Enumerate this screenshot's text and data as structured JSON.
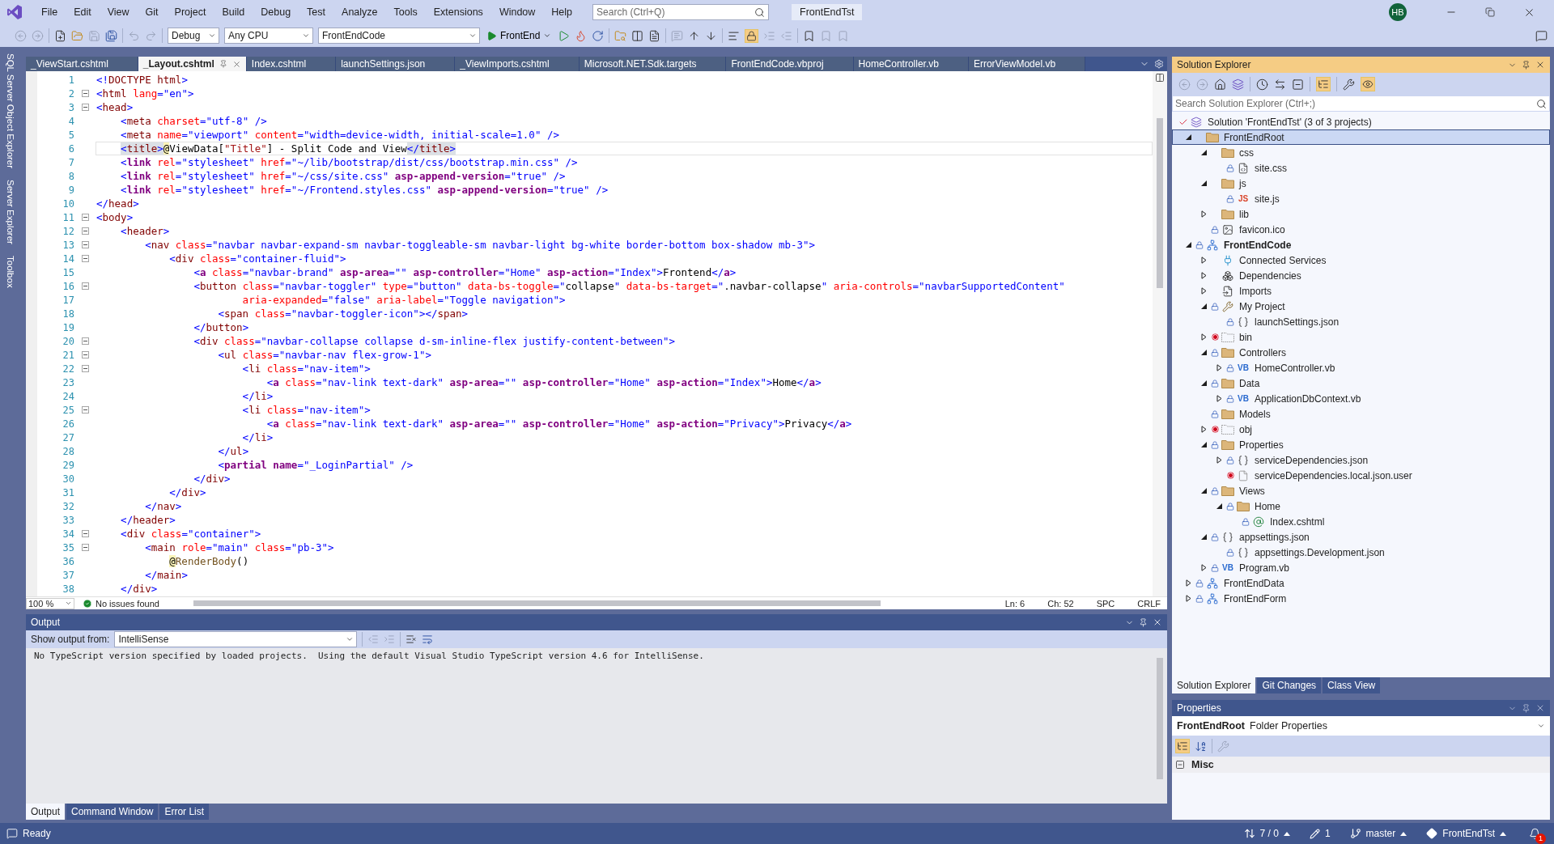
{
  "menu": [
    "File",
    "Edit",
    "View",
    "Git",
    "Project",
    "Build",
    "Debug",
    "Test",
    "Analyze",
    "Tools",
    "Extensions",
    "Window",
    "Help"
  ],
  "search": {
    "placeholder": "Search (Ctrl+Q)"
  },
  "solution_name": "FrontEndTst",
  "user_avatar": "HB",
  "toolbar": {
    "configuration": "Debug",
    "platform": "Any CPU",
    "startup_project": "FrontEndCode",
    "run_label": "FrontEnd"
  },
  "side_tabs": [
    "SQL Server Object Explorer",
    "Server Explorer",
    "Toolbox"
  ],
  "editor_tabs": [
    {
      "label": "_ViewStart.cshtml",
      "selected": false
    },
    {
      "label": "_Layout.cshtml",
      "selected": true
    },
    {
      "label": "Index.cshtml",
      "selected": false
    },
    {
      "label": "launchSettings.json",
      "selected": false
    },
    {
      "label": "_ViewImports.cshtml",
      "selected": false
    },
    {
      "label": "Microsoft.NET.Sdk.targets",
      "selected": false
    },
    {
      "label": "FrontEndCode.vbproj",
      "selected": false
    },
    {
      "label": "HomeController.vb",
      "selected": false
    },
    {
      "label": "ErrorViewModel.vb",
      "selected": false
    }
  ],
  "code_lines": [
    {
      "number": "1",
      "fold": false,
      "current": false,
      "tokens": [
        {
          "kind": "delim",
          "text": "<!"
        },
        {
          "kind": "tag",
          "text": "DOCTYPE html"
        },
        {
          "kind": "delim",
          "text": ">"
        }
      ]
    },
    {
      "number": "2",
      "fold": true,
      "current": false,
      "tokens": [
        {
          "kind": "delim",
          "text": "<"
        },
        {
          "kind": "tag",
          "text": "html "
        },
        {
          "kind": "attr",
          "text": "lang"
        },
        {
          "kind": "delim",
          "text": "=\"en\">"
        }
      ]
    },
    {
      "number": "3",
      "fold": true,
      "current": false,
      "tokens": [
        {
          "kind": "delim",
          "text": "<"
        },
        {
          "kind": "tag",
          "text": "head"
        },
        {
          "kind": "delim",
          "text": ">"
        }
      ]
    },
    {
      "number": "4",
      "fold": false,
      "current": false,
      "tokens": [
        {
          "kind": "delim",
          "text": "    <"
        },
        {
          "kind": "tag",
          "text": "meta "
        },
        {
          "kind": "attr",
          "text": "charset"
        },
        {
          "kind": "delim",
          "text": "=\"utf-8\" />"
        }
      ]
    },
    {
      "number": "5",
      "fold": false,
      "current": false,
      "tokens": [
        {
          "kind": "delim",
          "text": "    <"
        },
        {
          "kind": "tag",
          "text": "meta "
        },
        {
          "kind": "attr",
          "text": "name"
        },
        {
          "kind": "delim",
          "text": "=\"viewport\" "
        },
        {
          "kind": "attr",
          "text": "content"
        },
        {
          "kind": "delim",
          "text": "=\"width=device-width, initial-scale=1.0\" />"
        }
      ]
    },
    {
      "number": "6",
      "fold": false,
      "current": true,
      "tokens": [
        {
          "kind": "delim",
          "text": "    <",
          "matched": true
        },
        {
          "kind": "tag",
          "text": "title",
          "matched": true
        },
        {
          "kind": "delim",
          "text": ">",
          "matched": true
        },
        {
          "kind": "razor",
          "text": "@"
        },
        {
          "kind": "text",
          "text": "ViewData["
        },
        {
          "kind": "string",
          "text": "\"Title\""
        },
        {
          "kind": "text",
          "text": "] - Split Code and View"
        },
        {
          "kind": "delim",
          "text": "</",
          "matched": true
        },
        {
          "kind": "tag",
          "text": "title",
          "matched": true
        },
        {
          "kind": "delim",
          "text": ">",
          "matched": true
        }
      ]
    },
    {
      "number": "7",
      "fold": false,
      "current": false,
      "tokens": [
        {
          "kind": "delim",
          "text": "    <"
        },
        {
          "kind": "helper",
          "text": "link "
        },
        {
          "kind": "attr",
          "text": "rel"
        },
        {
          "kind": "delim",
          "text": "=\"stylesheet\" "
        },
        {
          "kind": "attr",
          "text": "href"
        },
        {
          "kind": "delim",
          "text": "=\"~/lib/bootstrap/dist/css/bootstrap.min.css\" />"
        }
      ]
    },
    {
      "number": "8",
      "fold": false,
      "current": false,
      "tokens": [
        {
          "kind": "delim",
          "text": "    <"
        },
        {
          "kind": "helper",
          "text": "link "
        },
        {
          "kind": "attr",
          "text": "rel"
        },
        {
          "kind": "delim",
          "text": "=\"stylesheet\" "
        },
        {
          "kind": "attr",
          "text": "href"
        },
        {
          "kind": "delim",
          "text": "=\"~/css/site.css\" "
        },
        {
          "kind": "helper",
          "text": "asp-append-version"
        },
        {
          "kind": "delim",
          "text": "=\"true\" />"
        }
      ]
    },
    {
      "number": "9",
      "fold": false,
      "current": false,
      "tokens": [
        {
          "kind": "delim",
          "text": "    <"
        },
        {
          "kind": "helper",
          "text": "link "
        },
        {
          "kind": "attr",
          "text": "rel"
        },
        {
          "kind": "delim",
          "text": "=\"stylesheet\" "
        },
        {
          "kind": "attr",
          "text": "href"
        },
        {
          "kind": "delim",
          "text": "=\"~/Frontend.styles.css\" "
        },
        {
          "kind": "helper",
          "text": "asp-append-version"
        },
        {
          "kind": "delim",
          "text": "=\"true\" />"
        }
      ]
    },
    {
      "number": "10",
      "fold": false,
      "current": false,
      "tokens": [
        {
          "kind": "delim",
          "text": "</"
        },
        {
          "kind": "tag",
          "text": "head"
        },
        {
          "kind": "delim",
          "text": ">"
        }
      ]
    },
    {
      "number": "11",
      "fold": true,
      "current": false,
      "tokens": [
        {
          "kind": "delim",
          "text": "<"
        },
        {
          "kind": "tag",
          "text": "body"
        },
        {
          "kind": "delim",
          "text": ">"
        }
      ]
    },
    {
      "number": "12",
      "fold": true,
      "current": false,
      "tokens": [
        {
          "kind": "delim",
          "text": "    <"
        },
        {
          "kind": "tag",
          "text": "header"
        },
        {
          "kind": "delim",
          "text": ">"
        }
      ]
    },
    {
      "number": "13",
      "fold": true,
      "current": false,
      "tokens": [
        {
          "kind": "delim",
          "text": "        <"
        },
        {
          "kind": "tag",
          "text": "nav "
        },
        {
          "kind": "attr",
          "text": "class"
        },
        {
          "kind": "delim",
          "text": "=\"navbar navbar-expand-sm navbar-toggleable-sm navbar-light bg-white border-bottom box-shadow mb-3\">"
        }
      ]
    },
    {
      "number": "14",
      "fold": true,
      "current": false,
      "tokens": [
        {
          "kind": "delim",
          "text": "            <"
        },
        {
          "kind": "tag",
          "text": "div "
        },
        {
          "kind": "attr",
          "text": "class"
        },
        {
          "kind": "delim",
          "text": "=\"container-fluid\">"
        }
      ]
    },
    {
      "number": "15",
      "fold": false,
      "current": false,
      "tokens": [
        {
          "kind": "delim",
          "text": "                <"
        },
        {
          "kind": "helper",
          "text": "a "
        },
        {
          "kind": "attr",
          "text": "class"
        },
        {
          "kind": "delim",
          "text": "=\"navbar-brand\" "
        },
        {
          "kind": "helper",
          "text": "asp-area"
        },
        {
          "kind": "delim",
          "text": "=\"\" "
        },
        {
          "kind": "helper",
          "text": "asp-controller"
        },
        {
          "kind": "delim",
          "text": "=\"Home\" "
        },
        {
          "kind": "helper",
          "text": "asp-action"
        },
        {
          "kind": "delim",
          "text": "=\"Index\">"
        },
        {
          "kind": "text",
          "text": "Frontend"
        },
        {
          "kind": "delim",
          "text": "</"
        },
        {
          "kind": "helper",
          "text": "a"
        },
        {
          "kind": "delim",
          "text": ">"
        }
      ]
    },
    {
      "number": "16",
      "fold": true,
      "current": false,
      "tokens": [
        {
          "kind": "delim",
          "text": "                <"
        },
        {
          "kind": "tag",
          "text": "button "
        },
        {
          "kind": "attr",
          "text": "class"
        },
        {
          "kind": "delim",
          "text": "=\"navbar-toggler\" "
        },
        {
          "kind": "attr",
          "text": "type"
        },
        {
          "kind": "delim",
          "text": "=\"button\" "
        },
        {
          "kind": "attr",
          "text": "data-bs-toggle"
        },
        {
          "kind": "delim",
          "text": "=\""
        },
        {
          "kind": "text",
          "text": "collapse"
        },
        {
          "kind": "delim",
          "text": "\" "
        },
        {
          "kind": "attr",
          "text": "data-bs-target"
        },
        {
          "kind": "delim",
          "text": "=\""
        },
        {
          "kind": "text",
          "text": ".navbar-collapse"
        },
        {
          "kind": "delim",
          "text": "\" "
        },
        {
          "kind": "attr",
          "text": "aria-controls"
        },
        {
          "kind": "delim",
          "text": "=\"navbarSupportedContent\""
        }
      ]
    },
    {
      "number": "17",
      "fold": false,
      "current": false,
      "tokens": [
        {
          "kind": "attr",
          "text": "                        aria-expanded"
        },
        {
          "kind": "delim",
          "text": "=\"false\" "
        },
        {
          "kind": "attr",
          "text": "aria-label"
        },
        {
          "kind": "delim",
          "text": "=\"Toggle navigation\">"
        }
      ]
    },
    {
      "number": "18",
      "fold": false,
      "current": false,
      "tokens": [
        {
          "kind": "delim",
          "text": "                    <"
        },
        {
          "kind": "tag",
          "text": "span "
        },
        {
          "kind": "attr",
          "text": "class"
        },
        {
          "kind": "delim",
          "text": "=\"navbar-toggler-icon\"></"
        },
        {
          "kind": "tag",
          "text": "span"
        },
        {
          "kind": "delim",
          "text": ">"
        }
      ]
    },
    {
      "number": "19",
      "fold": false,
      "current": false,
      "tokens": [
        {
          "kind": "delim",
          "text": "                </"
        },
        {
          "kind": "tag",
          "text": "button"
        },
        {
          "kind": "delim",
          "text": ">"
        }
      ]
    },
    {
      "number": "20",
      "fold": true,
      "current": false,
      "tokens": [
        {
          "kind": "delim",
          "text": "                <"
        },
        {
          "kind": "tag",
          "text": "div "
        },
        {
          "kind": "attr",
          "text": "class"
        },
        {
          "kind": "delim",
          "text": "=\"navbar-collapse collapse d-sm-inline-flex justify-content-between\">"
        }
      ]
    },
    {
      "number": "21",
      "fold": true,
      "current": false,
      "tokens": [
        {
          "kind": "delim",
          "text": "                    <"
        },
        {
          "kind": "tag",
          "text": "ul "
        },
        {
          "kind": "attr",
          "text": "class"
        },
        {
          "kind": "delim",
          "text": "=\"navbar-nav flex-grow-1\">"
        }
      ]
    },
    {
      "number": "22",
      "fold": true,
      "current": false,
      "tokens": [
        {
          "kind": "delim",
          "text": "                        <"
        },
        {
          "kind": "tag",
          "text": "li "
        },
        {
          "kind": "attr",
          "text": "class"
        },
        {
          "kind": "delim",
          "text": "=\"nav-item\">"
        }
      ]
    },
    {
      "number": "23",
      "fold": false,
      "current": false,
      "tokens": [
        {
          "kind": "delim",
          "text": "                            <"
        },
        {
          "kind": "helper",
          "text": "a "
        },
        {
          "kind": "attr",
          "text": "class"
        },
        {
          "kind": "delim",
          "text": "=\"nav-link text-dark\" "
        },
        {
          "kind": "helper",
          "text": "asp-area"
        },
        {
          "kind": "delim",
          "text": "=\"\" "
        },
        {
          "kind": "helper",
          "text": "asp-controller"
        },
        {
          "kind": "delim",
          "text": "=\"Home\" "
        },
        {
          "kind": "helper",
          "text": "asp-action"
        },
        {
          "kind": "delim",
          "text": "=\"Index\">"
        },
        {
          "kind": "text",
          "text": "Home"
        },
        {
          "kind": "delim",
          "text": "</"
        },
        {
          "kind": "helper",
          "text": "a"
        },
        {
          "kind": "delim",
          "text": ">"
        }
      ]
    },
    {
      "number": "24",
      "fold": false,
      "current": false,
      "tokens": [
        {
          "kind": "delim",
          "text": "                        </"
        },
        {
          "kind": "tag",
          "text": "li"
        },
        {
          "kind": "delim",
          "text": ">"
        }
      ]
    },
    {
      "number": "25",
      "fold": true,
      "current": false,
      "tokens": [
        {
          "kind": "delim",
          "text": "                        <"
        },
        {
          "kind": "tag",
          "text": "li "
        },
        {
          "kind": "attr",
          "text": "class"
        },
        {
          "kind": "delim",
          "text": "=\"nav-item\">"
        }
      ]
    },
    {
      "number": "26",
      "fold": false,
      "current": false,
      "tokens": [
        {
          "kind": "delim",
          "text": "                            <"
        },
        {
          "kind": "helper",
          "text": "a "
        },
        {
          "kind": "attr",
          "text": "class"
        },
        {
          "kind": "delim",
          "text": "=\"nav-link text-dark\" "
        },
        {
          "kind": "helper",
          "text": "asp-area"
        },
        {
          "kind": "delim",
          "text": "=\"\" "
        },
        {
          "kind": "helper",
          "text": "asp-controller"
        },
        {
          "kind": "delim",
          "text": "=\"Home\" "
        },
        {
          "kind": "helper",
          "text": "asp-action"
        },
        {
          "kind": "delim",
          "text": "=\"Privacy\">"
        },
        {
          "kind": "text",
          "text": "Privacy"
        },
        {
          "kind": "delim",
          "text": "</"
        },
        {
          "kind": "helper",
          "text": "a"
        },
        {
          "kind": "delim",
          "text": ">"
        }
      ]
    },
    {
      "number": "27",
      "fold": false,
      "current": false,
      "tokens": [
        {
          "kind": "delim",
          "text": "                        </"
        },
        {
          "kind": "tag",
          "text": "li"
        },
        {
          "kind": "delim",
          "text": ">"
        }
      ]
    },
    {
      "number": "28",
      "fold": false,
      "current": false,
      "tokens": [
        {
          "kind": "delim",
          "text": "                    </"
        },
        {
          "kind": "tag",
          "text": "ul"
        },
        {
          "kind": "delim",
          "text": ">"
        }
      ]
    },
    {
      "number": "29",
      "fold": false,
      "current": false,
      "tokens": [
        {
          "kind": "delim",
          "text": "                    <"
        },
        {
          "kind": "helper",
          "text": "partial "
        },
        {
          "kind": "helper",
          "text": "name"
        },
        {
          "kind": "delim",
          "text": "=\"_LoginPartial\" />"
        }
      ]
    },
    {
      "number": "30",
      "fold": false,
      "current": false,
      "tokens": [
        {
          "kind": "delim",
          "text": "                </"
        },
        {
          "kind": "tag",
          "text": "div"
        },
        {
          "kind": "delim",
          "text": ">"
        }
      ]
    },
    {
      "number": "31",
      "fold": false,
      "current": false,
      "tokens": [
        {
          "kind": "delim",
          "text": "            </"
        },
        {
          "kind": "tag",
          "text": "div"
        },
        {
          "kind": "delim",
          "text": ">"
        }
      ]
    },
    {
      "number": "32",
      "fold": false,
      "current": false,
      "tokens": [
        {
          "kind": "delim",
          "text": "        </"
        },
        {
          "kind": "tag",
          "text": "nav"
        },
        {
          "kind": "delim",
          "text": ">"
        }
      ]
    },
    {
      "number": "33",
      "fold": false,
      "current": false,
      "tokens": [
        {
          "kind": "delim",
          "text": "    </"
        },
        {
          "kind": "tag",
          "text": "header"
        },
        {
          "kind": "delim",
          "text": ">"
        }
      ]
    },
    {
      "number": "34",
      "fold": true,
      "current": false,
      "tokens": [
        {
          "kind": "delim",
          "text": "    <"
        },
        {
          "kind": "tag",
          "text": "div "
        },
        {
          "kind": "attr",
          "text": "class"
        },
        {
          "kind": "delim",
          "text": "=\"container\">"
        }
      ]
    },
    {
      "number": "35",
      "fold": true,
      "current": false,
      "tokens": [
        {
          "kind": "delim",
          "text": "        <"
        },
        {
          "kind": "tag",
          "text": "main "
        },
        {
          "kind": "attr",
          "text": "role"
        },
        {
          "kind": "delim",
          "text": "=\"main\" "
        },
        {
          "kind": "attr",
          "text": "class"
        },
        {
          "kind": "delim",
          "text": "=\"pb-3\">"
        }
      ]
    },
    {
      "number": "36",
      "fold": false,
      "current": false,
      "tokens": [
        {
          "kind": "razor",
          "text": "            @"
        },
        {
          "kind": "method",
          "text": "RenderBody"
        },
        {
          "kind": "text",
          "text": "()"
        }
      ]
    },
    {
      "number": "37",
      "fold": false,
      "current": false,
      "tokens": [
        {
          "kind": "delim",
          "text": "        </"
        },
        {
          "kind": "tag",
          "text": "main"
        },
        {
          "kind": "delim",
          "text": ">"
        }
      ]
    },
    {
      "number": "38",
      "fold": false,
      "current": false,
      "tokens": [
        {
          "kind": "delim",
          "text": "    </"
        },
        {
          "kind": "tag",
          "text": "div"
        },
        {
          "kind": "delim",
          "text": ">"
        }
      ]
    }
  ],
  "editor_status": {
    "zoom": "100 %",
    "issues": "No issues found",
    "line": "Ln: 6",
    "column": "Ch: 52",
    "spacing": "SPC",
    "line_ending": "CRLF"
  },
  "output": {
    "title": "Output",
    "source_label": "Show output from:",
    "source": "IntelliSense",
    "text": "No TypeScript version specified by loaded projects.  Using the default Visual Studio TypeScript version 4.6 for IntelliSense.",
    "tabs": [
      {
        "label": "Output",
        "selected": true
      },
      {
        "label": "Command Window",
        "selected": false
      },
      {
        "label": "Error List",
        "selected": false
      }
    ]
  },
  "solution_explorer": {
    "title": "Solution Explorer",
    "search_placeholder": "Search Solution Explorer (Ctrl+;)",
    "tree": {
      "label": "Solution 'FrontEndTst' (3 of 3 projects)",
      "kind": "solution",
      "locked": false,
      "excluded": false,
      "selected": false,
      "children": [
        {
          "label": "FrontEndRoot",
          "kind": "folder",
          "locked": false,
          "excluded": false,
          "expanded": true,
          "selected": true,
          "children": [
            {
              "label": "css",
              "kind": "folder",
              "locked": false,
              "excluded": false,
              "expanded": true,
              "selected": false,
              "children": [
                {
                  "label": "site.css",
                  "kind": "css",
                  "locked": true,
                  "excluded": false,
                  "selected": false
                }
              ]
            },
            {
              "label": "js",
              "kind": "folder",
              "locked": false,
              "excluded": false,
              "expanded": true,
              "selected": false,
              "children": [
                {
                  "label": "site.js",
                  "kind": "js",
                  "badge": "JS",
                  "locked": true,
                  "excluded": false,
                  "selected": false
                }
              ]
            },
            {
              "label": "lib",
              "kind": "folder",
              "locked": false,
              "excluded": false,
              "expanded": false,
              "selected": false
            },
            {
              "label": "favicon.ico",
              "kind": "image",
              "locked": true,
              "excluded": false,
              "selected": false
            }
          ]
        },
        {
          "label": "FrontEndCode",
          "kind": "project",
          "locked": true,
          "excluded": false,
          "expanded": true,
          "startup": true,
          "selected": false,
          "children": [
            {
              "label": "Connected Services",
              "kind": "connected",
              "locked": false,
              "excluded": false,
              "expanded": false,
              "selected": false
            },
            {
              "label": "Dependencies",
              "kind": "dependencies",
              "locked": false,
              "excluded": false,
              "expanded": false,
              "selected": false
            },
            {
              "label": "Imports",
              "kind": "imports",
              "locked": false,
              "excluded": false,
              "expanded": false,
              "selected": false
            },
            {
              "label": "My Project",
              "kind": "settings",
              "locked": true,
              "excluded": false,
              "expanded": true,
              "selected": false,
              "children": [
                {
                  "label": "launchSettings.json",
                  "kind": "json",
                  "locked": true,
                  "excluded": false,
                  "selected": false
                }
              ]
            },
            {
              "label": "bin",
              "kind": "hidden-folder",
              "locked": false,
              "excluded": true,
              "expanded": false,
              "selected": false
            },
            {
              "label": "Controllers",
              "kind": "folder",
              "locked": true,
              "excluded": false,
              "expanded": true,
              "selected": false,
              "children": [
                {
                  "label": "HomeController.vb",
                  "kind": "vb",
                  "badge": "VB",
                  "locked": true,
                  "excluded": false,
                  "expanded": false,
                  "selected": false
                }
              ]
            },
            {
              "label": "Data",
              "kind": "folder",
              "locked": true,
              "excluded": false,
              "expanded": true,
              "selected": false,
              "children": [
                {
                  "label": "ApplicationDbContext.vb",
                  "kind": "vb",
                  "badge": "VB",
                  "locked": true,
                  "excluded": false,
                  "expanded": false,
                  "selected": false
                }
              ]
            },
            {
              "label": "Models",
              "kind": "folder",
              "locked": true,
              "excluded": false,
              "selected": false
            },
            {
              "label": "obj",
              "kind": "hidden-folder",
              "locked": false,
              "excluded": true,
              "expanded": false,
              "selected": false
            },
            {
              "label": "Properties",
              "kind": "folder",
              "locked": true,
              "excluded": false,
              "expanded": true,
              "selected": false,
              "children": [
                {
                  "label": "serviceDependencies.json",
                  "kind": "json",
                  "locked": true,
                  "excluded": false,
                  "expanded": false,
                  "selected": false
                },
                {
                  "label": "serviceDependencies.local.json.user",
                  "kind": "hidden-file",
                  "locked": false,
                  "excluded": true,
                  "selected": false
                }
              ]
            },
            {
              "label": "Views",
              "kind": "folder",
              "locked": true,
              "excluded": false,
              "expanded": true,
              "selected": false,
              "children": [
                {
                  "label": "Home",
                  "kind": "folder",
                  "locked": true,
                  "excluded": false,
                  "expanded": true,
                  "selected": false,
                  "children": [
                    {
                      "label": "Index.cshtml",
                      "kind": "razor",
                      "locked": true,
                      "excluded": false,
                      "selected": false
                    }
                  ]
                }
              ]
            },
            {
              "label": "appsettings.json",
              "kind": "json",
              "locked": true,
              "excluded": false,
              "expanded": true,
              "selected": false,
              "children": [
                {
                  "label": "appsettings.Development.json",
                  "kind": "json",
                  "locked": true,
                  "excluded": false,
                  "selected": false
                }
              ]
            },
            {
              "label": "Program.vb",
              "kind": "vb",
              "badge": "VB",
              "locked": true,
              "excluded": false,
              "expanded": false,
              "selected": false
            }
          ]
        },
        {
          "label": "FrontEndData",
          "kind": "project",
          "locked": true,
          "excluded": false,
          "expanded": false,
          "selected": false
        },
        {
          "label": "FrontEndForm",
          "kind": "project",
          "locked": true,
          "excluded": false,
          "expanded": false,
          "selected": false
        }
      ]
    },
    "tabs": [
      {
        "label": "Solution Explorer",
        "selected": true
      },
      {
        "label": "Git Changes",
        "selected": false
      },
      {
        "label": "Class View",
        "selected": false
      }
    ]
  },
  "properties": {
    "title": "Properties",
    "object": "FrontEndRoot",
    "object_type": "Folder Properties",
    "category": "Misc",
    "category_expanded": true
  },
  "status_bar": {
    "ready": "Ready",
    "changes": "7 / 0",
    "edits": "1",
    "branch": "master",
    "repository": "FrontEndTst",
    "notifications": "1"
  }
}
